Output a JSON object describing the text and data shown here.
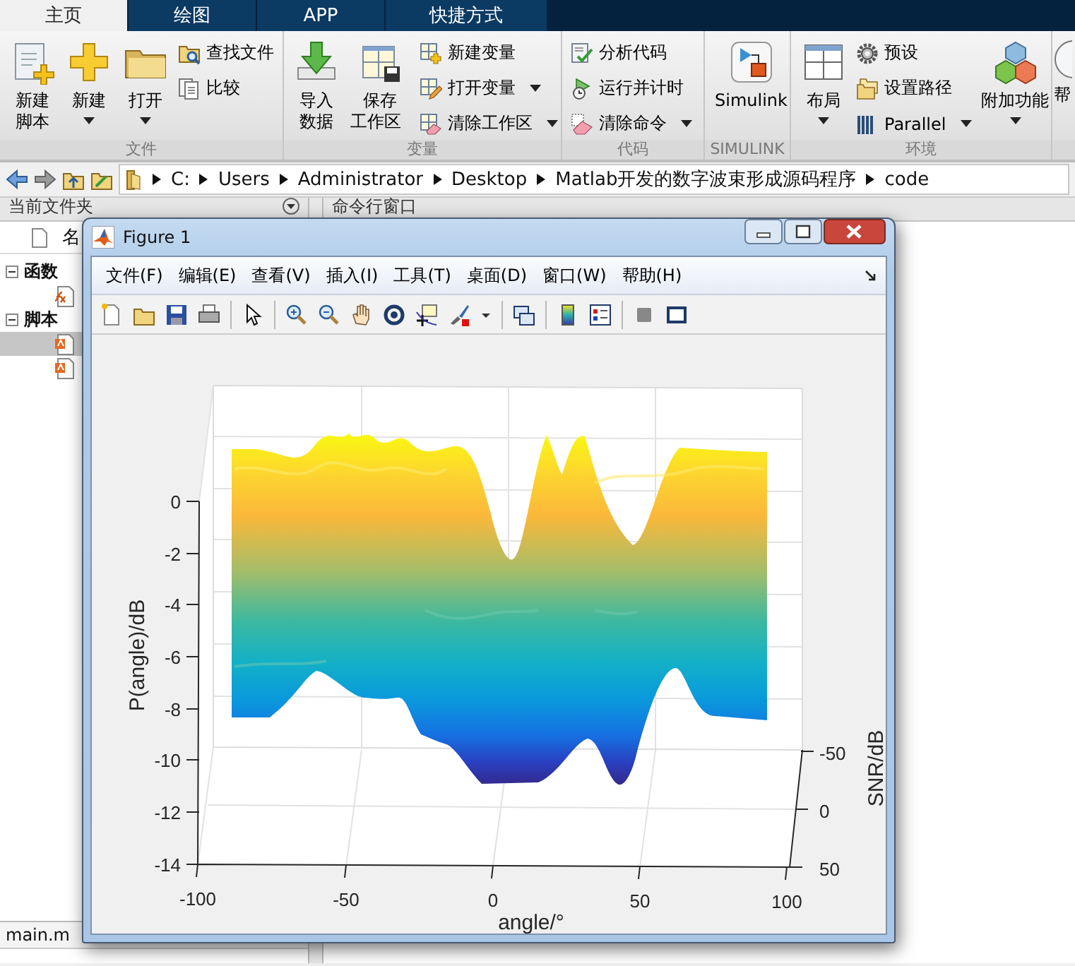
{
  "tabs": [
    {
      "label": "主页",
      "selected": true
    },
    {
      "label": "绘图",
      "selected": false
    },
    {
      "label": "APP",
      "selected": false
    },
    {
      "label": "快捷方式",
      "selected": false
    }
  ],
  "ribbon": {
    "groups": [
      {
        "label": "文件",
        "columns": [
          [
            {
              "kind": "large2",
              "label": "新建脚本",
              "dropdown": false
            }
          ],
          [
            {
              "kind": "large",
              "label": "新建",
              "dropdown": true
            }
          ],
          [
            {
              "kind": "large",
              "label": "打开",
              "dropdown": true
            }
          ],
          [
            {
              "kind": "small",
              "label": "查找文件",
              "dropdown": false
            },
            {
              "kind": "small",
              "label": "比较",
              "dropdown": false
            }
          ]
        ]
      },
      {
        "label": "变量",
        "columns": [
          [
            {
              "kind": "large2",
              "label": "导入数据",
              "dropdown": false
            }
          ],
          [
            {
              "kind": "large2",
              "label": "保存工作区",
              "dropdown": false
            }
          ],
          [
            {
              "kind": "small",
              "label": "新建变量",
              "dropdown": false
            },
            {
              "kind": "small",
              "label": "打开变量",
              "dropdown": true
            },
            {
              "kind": "small",
              "label": "清除工作区",
              "dropdown": true
            }
          ]
        ]
      },
      {
        "label": "代码",
        "columns": [
          [
            {
              "kind": "small",
              "label": "分析代码",
              "dropdown": false
            },
            {
              "kind": "small",
              "label": "运行并计时",
              "dropdown": false
            },
            {
              "kind": "small",
              "label": "清除命令",
              "dropdown": true
            }
          ]
        ]
      },
      {
        "label": "SIMULINK",
        "columns": [
          [
            {
              "kind": "large",
              "label": "Simulink",
              "dropdown": false
            }
          ]
        ]
      },
      {
        "label": "环境",
        "columns": [
          [
            {
              "kind": "large",
              "label": "布局",
              "dropdown": true
            }
          ],
          [
            {
              "kind": "small",
              "label": "预设",
              "dropdown": false
            },
            {
              "kind": "small",
              "label": "设置路径",
              "dropdown": false
            },
            {
              "kind": "small",
              "label": "Parallel",
              "dropdown": true
            }
          ],
          [
            {
              "kind": "large",
              "label": "附加功能",
              "dropdown": true
            }
          ]
        ]
      },
      {
        "columns": [
          [
            {
              "kind": "large",
              "label": "帮",
              "dropdown": false
            }
          ]
        ]
      }
    ]
  },
  "address_bar": {
    "path": [
      "C:",
      "Users",
      "Administrator",
      "Desktop",
      "Matlab开发的数字波束形成源码程序",
      "code"
    ]
  },
  "current_folder": {
    "title": "当前文件夹",
    "column": "名",
    "tree": [
      {
        "label": "函数",
        "expanded": true,
        "children": [
          {
            "kind": "function",
            "selected": false
          }
        ]
      },
      {
        "label": "脚本",
        "expanded": true,
        "children": [
          {
            "kind": "script",
            "selected": true
          },
          {
            "kind": "script",
            "selected": false
          }
        ]
      }
    ],
    "details_file": "main.m"
  },
  "command_window": {
    "title": "命令行窗口"
  },
  "figure": {
    "title": "Figure 1",
    "menus": [
      "文件(F)",
      "编辑(E)",
      "查看(V)",
      "插入(I)",
      "工具(T)",
      "桌面(D)",
      "窗口(W)",
      "帮助(H)"
    ],
    "plot": {
      "xlabel": "angle/°",
      "ylabel": "SNR/dB",
      "zlabel": "P(angle)/dB",
      "x_ticks": [
        "-100",
        "-50",
        "0",
        "50",
        "100"
      ],
      "y_ticks": [
        "-50",
        "0",
        "50"
      ],
      "z_ticks": [
        "0",
        "-2",
        "-4",
        "-6",
        "-8",
        "-10",
        "-12",
        "-14"
      ]
    }
  }
}
